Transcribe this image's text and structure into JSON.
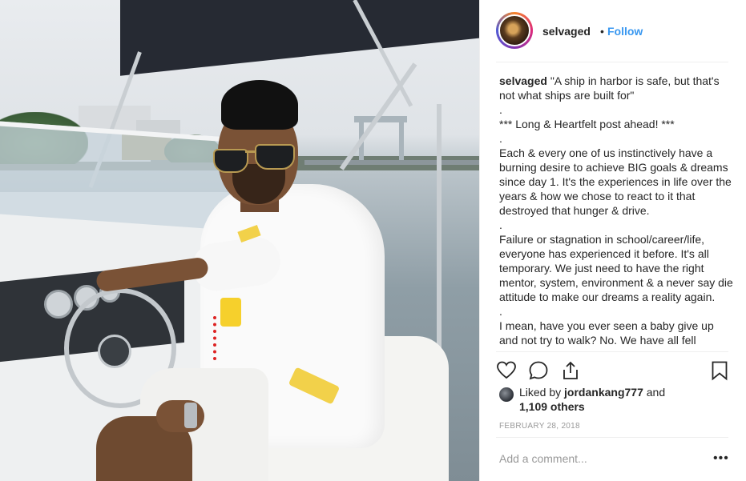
{
  "header": {
    "username": "selvaged",
    "separator": "•",
    "follow_label": "Follow"
  },
  "caption": {
    "username": "selvaged",
    "lines": [
      "\"A ship in harbor is safe, but that's not what ships are built for\"",
      ".",
      "*** Long & Heartfelt post ahead! ***",
      ".",
      "Each & every one of us instinctively have a burning desire to achieve BIG goals & dreams since day 1. It's the experiences in life over the years & how we chose to react to it that destroyed that hunger & drive.",
      ".",
      "Failure or stagnation in school/career/life, everyone has experienced it before. It's all temporary. We just need to have the right mentor, system, environment & a never say die attitude to make our dreams a reality again.",
      ".",
      "I mean, have you ever seen a baby give up and not try to walk? No. We have all fell"
    ]
  },
  "actions": {
    "like_icon": "heart-icon",
    "comment_icon": "speech-bubble-icon",
    "share_icon": "share-icon",
    "save_icon": "bookmark-icon"
  },
  "likes": {
    "prefix": "Liked by",
    "user": "jordankang777",
    "conjunction": "and",
    "others": "1,109 others"
  },
  "date": "FEBRUARY 28, 2018",
  "comment_box": {
    "placeholder": "Add a comment...",
    "more_label": "•••"
  },
  "colors": {
    "link_blue": "#3897f0",
    "text": "#262626",
    "muted": "#999999",
    "divider": "#efefef"
  }
}
